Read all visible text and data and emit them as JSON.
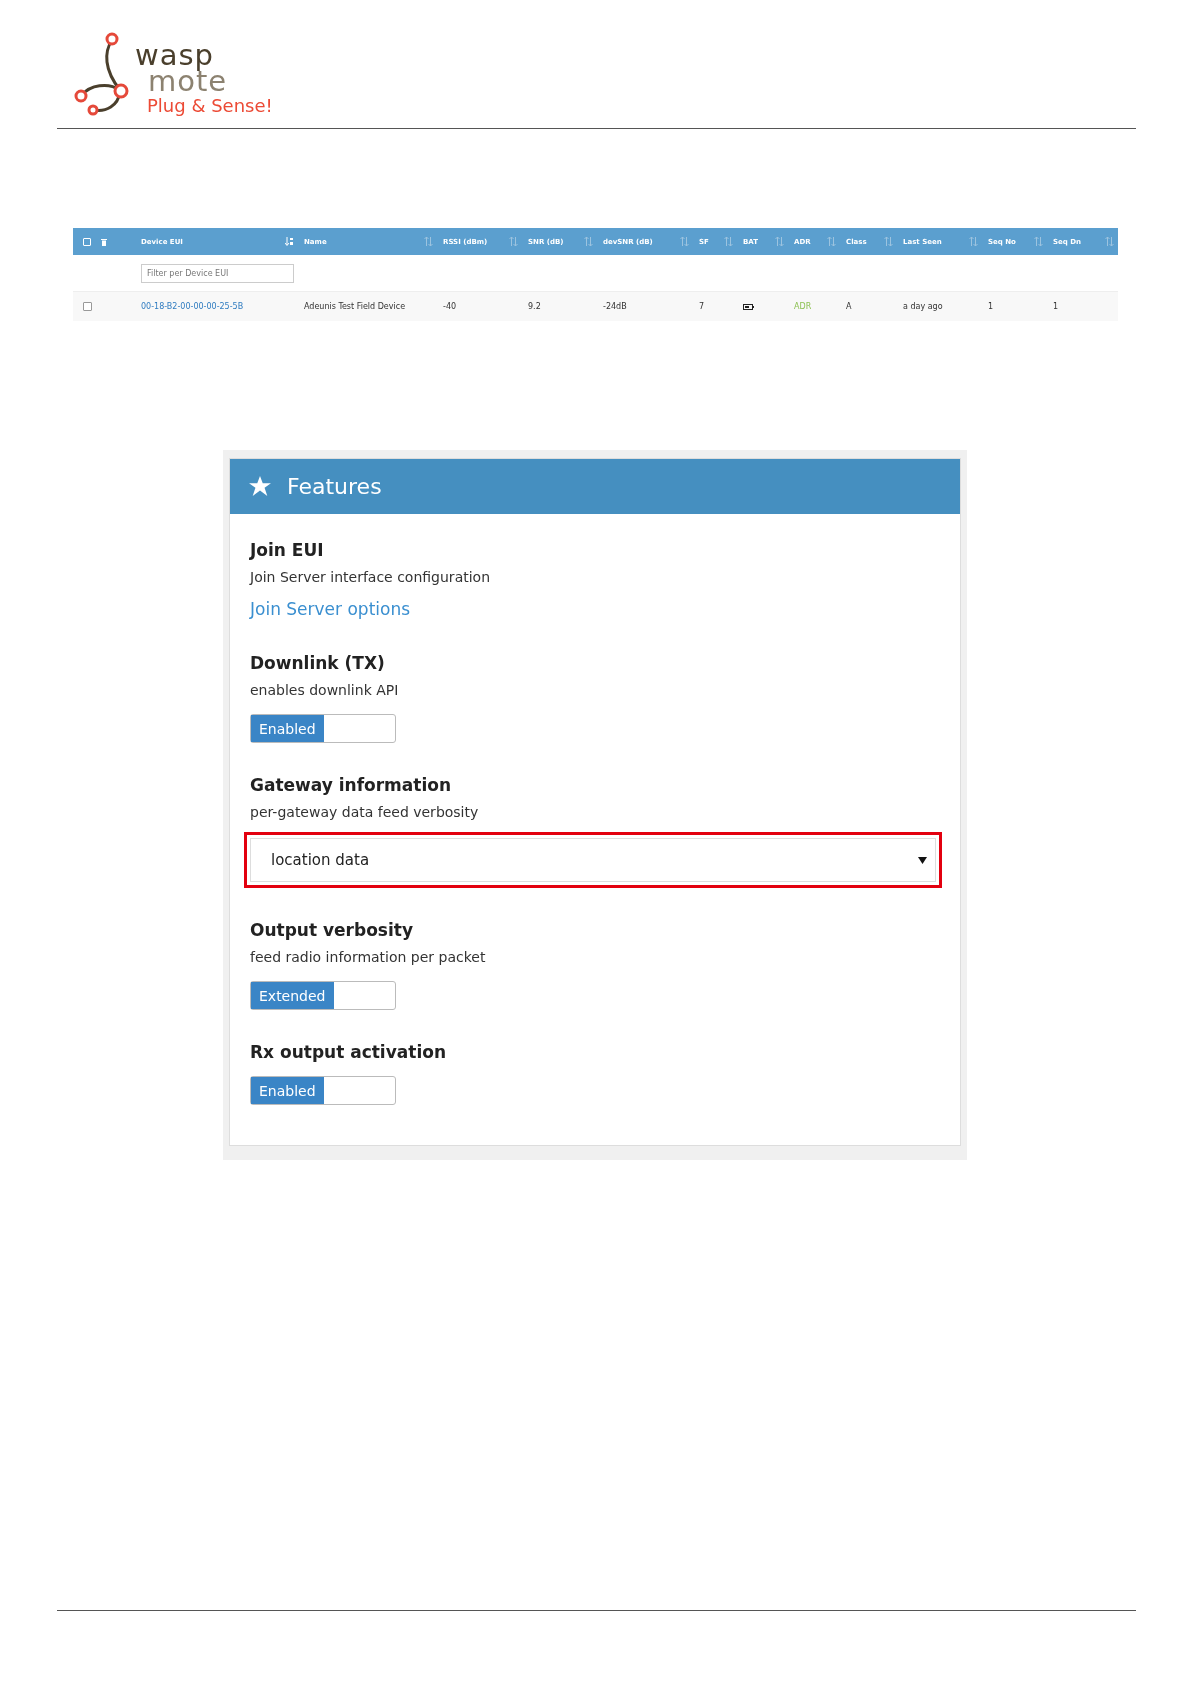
{
  "logo": {
    "line_1": "wasp",
    "line_2": "mote",
    "tagline": "Plug & Sense!"
  },
  "devices_table": {
    "select_all_checked": false,
    "columns": [
      {
        "label": "Device EUI",
        "sorted": true
      },
      {
        "label": "Name",
        "sorted": false
      },
      {
        "label": "RSSI (dBm)",
        "sorted": false
      },
      {
        "label": "SNR (dB)",
        "sorted": false
      },
      {
        "label": "devSNR (dB)",
        "sorted": false
      },
      {
        "label": "SF",
        "sorted": false
      },
      {
        "label": "BAT",
        "sorted": false
      },
      {
        "label": "ADR",
        "sorted": false
      },
      {
        "label": "Class",
        "sorted": false
      },
      {
        "label": "Last Seen",
        "sorted": false
      },
      {
        "label": "Seq No",
        "sorted": false
      },
      {
        "label": "Seq Dn",
        "sorted": false
      }
    ],
    "filter": {
      "placeholder": "Filter per Device EUI"
    },
    "rows": [
      {
        "checked": false,
        "cells": [
          {
            "kind": "link",
            "text": "00-18-B2-00-00-00-25-5B"
          },
          {
            "kind": "text",
            "text": "Adeunis Test Field Device"
          },
          {
            "kind": "text",
            "text": "-40"
          },
          {
            "kind": "text",
            "text": "9.2"
          },
          {
            "kind": "text",
            "text": "-24dB"
          },
          {
            "kind": "text",
            "text": "7"
          },
          {
            "kind": "battery"
          },
          {
            "kind": "flag",
            "text": "ADR"
          },
          {
            "kind": "text",
            "text": "A"
          },
          {
            "kind": "text",
            "text": "a day ago"
          },
          {
            "kind": "text",
            "text": "1"
          },
          {
            "kind": "text",
            "text": "1"
          }
        ]
      }
    ]
  },
  "features_panel": {
    "title": "Features",
    "sections": [
      {
        "kind": "link",
        "heading": "Join EUI",
        "description": "Join Server interface configuration",
        "link": "Join Server options"
      },
      {
        "kind": "toggle",
        "heading": "Downlink (TX)",
        "description": "enables downlink API",
        "label": "Enabled",
        "on": true
      },
      {
        "kind": "select",
        "heading": "Gateway information",
        "description": "per-gateway data feed verbosity",
        "value": "location data",
        "highlighted": true
      },
      {
        "kind": "toggle",
        "heading": "Output verbosity",
        "description": "feed radio information per packet",
        "label": "Extended",
        "on": true
      },
      {
        "kind": "toggle",
        "heading": "Rx output activation",
        "label": "Enabled",
        "on": true
      }
    ]
  }
}
